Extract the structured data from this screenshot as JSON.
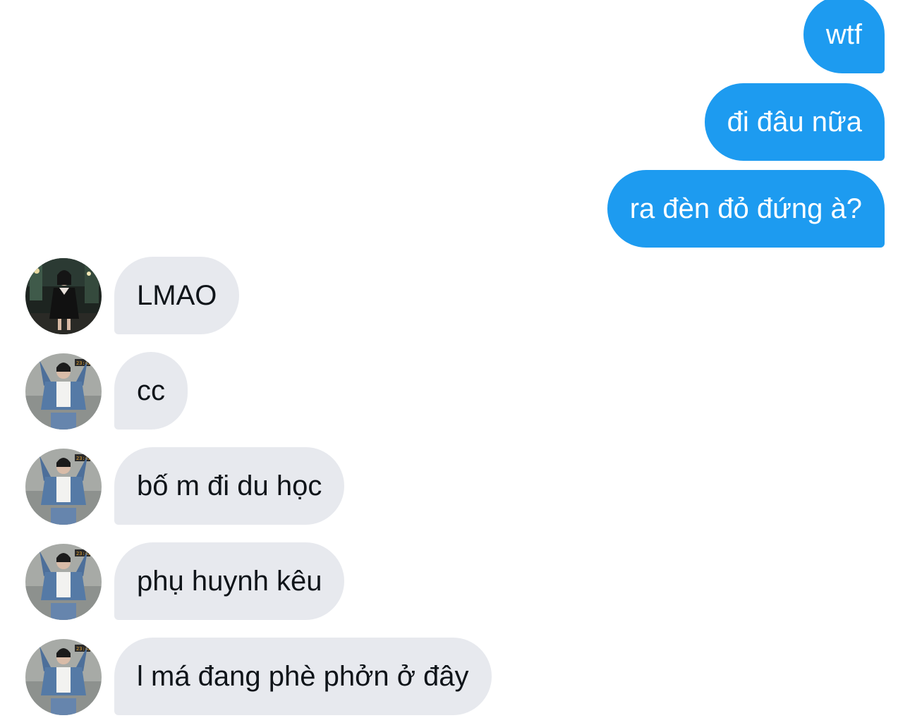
{
  "messages": {
    "sent": [
      {
        "text": "wtf"
      },
      {
        "text": "đi đâu nữa"
      },
      {
        "text": "ra đèn đỏ đứng à?"
      }
    ],
    "received": [
      {
        "text": "LMAO",
        "avatar": "avatar-night-street"
      },
      {
        "text": "cc",
        "avatar": "avatar-denim-jacket"
      },
      {
        "text": "bố m đi du học",
        "avatar": "avatar-denim-jacket"
      },
      {
        "text": "phụ huynh kêu",
        "avatar": "avatar-denim-jacket"
      },
      {
        "text": "l má đang phè phởn ở đây",
        "avatar": "avatar-denim-jacket"
      }
    ]
  },
  "colors": {
    "sent_bubble": "#1d9bf0",
    "received_bubble": "#e7e9ee",
    "received_text": "#0f1419"
  }
}
